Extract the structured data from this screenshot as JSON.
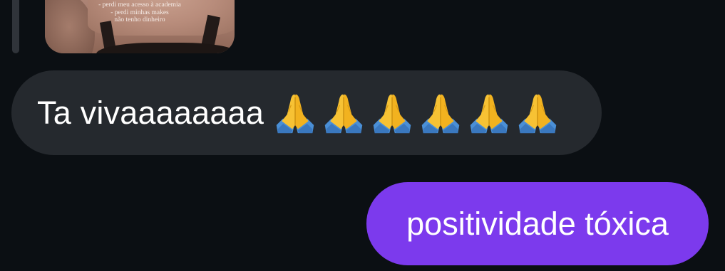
{
  "story_reply": {
    "caption_lines": [
      "- perdi meu acesso à academia",
      "- perdi minhas makes",
      "não tenho dinheiro"
    ]
  },
  "messages": [
    {
      "direction": "incoming",
      "text": "Ta vivaaaaaaaa",
      "emoji": [
        "folded-hands",
        "folded-hands",
        "folded-hands",
        "folded-hands",
        "folded-hands",
        "folded-hands"
      ],
      "bubble_color": "#25292e"
    },
    {
      "direction": "outgoing",
      "text": "positividade tóxica",
      "bubble_color": "#7c3aed"
    }
  ],
  "colors": {
    "background": "#0b0f13",
    "reply_bar": "#30343a",
    "text": "#ffffff"
  }
}
